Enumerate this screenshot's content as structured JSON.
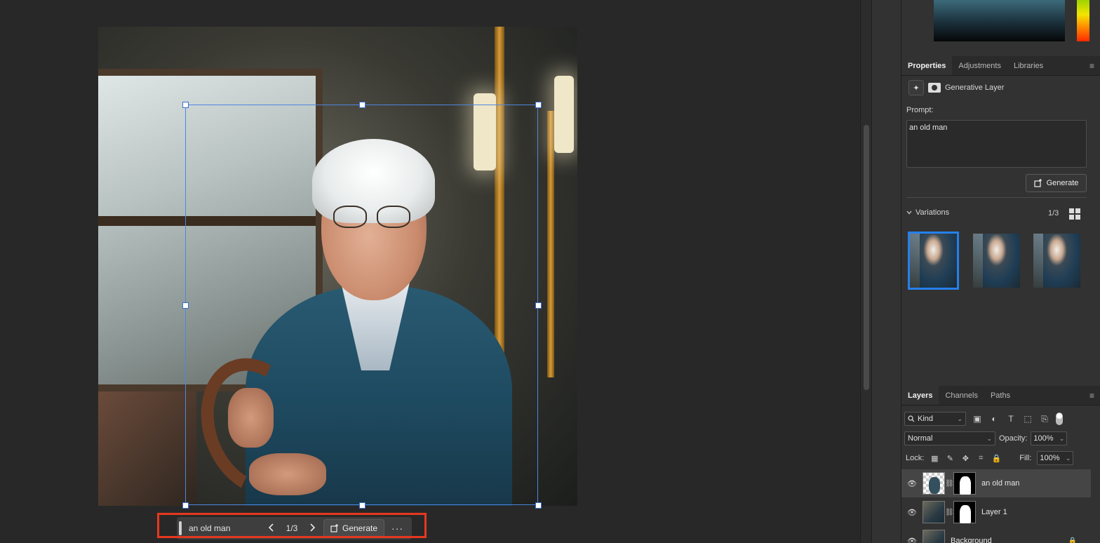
{
  "app": {
    "accent_color": "#2680eb",
    "highlight_color": "#e5381e",
    "selection_color": "#4d86e0"
  },
  "taskbar": {
    "prompt": "an old man",
    "prev_icon": "chevron-left-icon",
    "next_icon": "chevron-right-icon",
    "variation_counter": "1/3",
    "generate_label": "Generate",
    "more_label": "···"
  },
  "properties_panel": {
    "tabs": [
      "Properties",
      "Adjustments",
      "Libraries"
    ],
    "active_tab": "Properties",
    "layer_type": "Generative Layer",
    "prompt_label": "Prompt:",
    "prompt_value": "an old man",
    "generate_label": "Generate",
    "variations_label": "Variations",
    "variations_count": "1/3",
    "variations": [
      {
        "name": "variation-1",
        "selected": true
      },
      {
        "name": "variation-2",
        "selected": false
      },
      {
        "name": "variation-3",
        "selected": false
      }
    ]
  },
  "layers_panel": {
    "tabs": [
      "Layers",
      "Channels",
      "Paths"
    ],
    "active_tab": "Layers",
    "filter_kind": "Kind",
    "blend_mode": "Normal",
    "opacity_label": "Opacity:",
    "opacity_value": "100%",
    "lock_label": "Lock:",
    "fill_label": "Fill:",
    "fill_value": "100%",
    "layers": [
      {
        "name": "an old man",
        "active": true,
        "has_mask": true
      },
      {
        "name": "Layer 1",
        "active": false,
        "has_mask": true
      },
      {
        "name": "Background",
        "active": false,
        "locked": true
      }
    ]
  }
}
